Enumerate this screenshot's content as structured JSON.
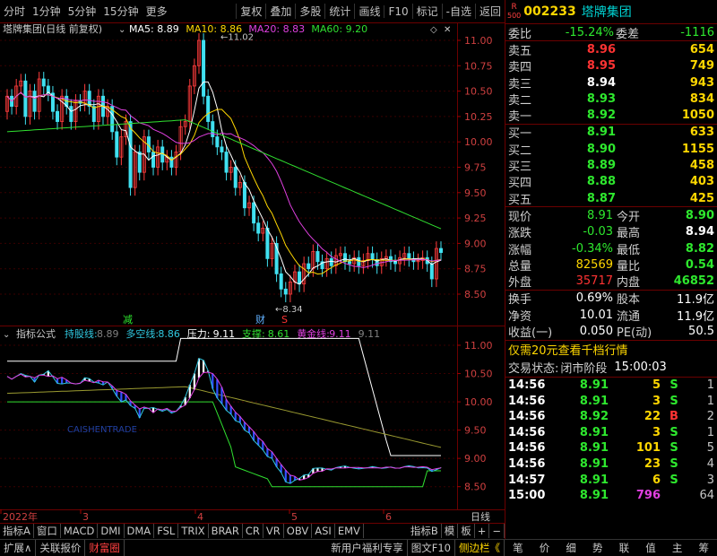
{
  "toolbar": {
    "periods": [
      "分时",
      "1分钟",
      "5分钟",
      "15分钟",
      "更多"
    ],
    "actions": [
      "复权",
      "叠加",
      "多股",
      "统计",
      "画线",
      "F10",
      "标记",
      "-自选",
      "返回"
    ]
  },
  "main_chart": {
    "title": "塔牌集团(日线 前复权)",
    "ma": [
      {
        "label": "MA5: 8.89",
        "color": "#ffffff"
      },
      {
        "label": "MA10: 8.86",
        "color": "#ffd700"
      },
      {
        "label": "MA20: 8.83",
        "color": "#e040e0"
      },
      {
        "label": "MA60: 9.20",
        "color": "#30e030"
      }
    ],
    "y_ticks": [
      "11.00",
      "10.75",
      "10.50",
      "10.25",
      "10.00",
      "9.75",
      "9.50",
      "9.25",
      "9.00",
      "8.75",
      "8.50"
    ],
    "high_label": "11.02",
    "low_label": "8.34",
    "markers": {
      "jian": "减",
      "cai": "财",
      "s": "S"
    }
  },
  "sub_chart": {
    "indicator": "指标公式",
    "items": [
      {
        "label": "持股线: ",
        "value": "8.89",
        "lc": "#30c8e0",
        "vc": "#808080"
      },
      {
        "label": "多空线: ",
        "value": "8.86",
        "lc": "#30c8e0",
        "vc": "#30c8e0"
      },
      {
        "label": "压力: ",
        "value": "9.11",
        "lc": "#ffffff",
        "vc": "#ffffff"
      },
      {
        "label": "支撑: ",
        "value": "8.61",
        "lc": "#30e030",
        "vc": "#30e030"
      },
      {
        "label": "黄金线: ",
        "value": "9.11",
        "lc": "#e040e0",
        "vc": "#e040e0"
      },
      {
        "label": "",
        "value": "9.11",
        "lc": "#808080",
        "vc": "#808080"
      }
    ],
    "y_ticks": [
      "11.00",
      "10.50",
      "10.00",
      "9.50",
      "9.00",
      "8.50"
    ],
    "watermark": "CAISHENTRADE"
  },
  "x_axis": {
    "labels": [
      "2022年",
      "3",
      "4",
      "5",
      "6"
    ],
    "period": "日线"
  },
  "indicator_tabs": [
    "指标A",
    "窗口",
    "MACD",
    "DMI",
    "DMA",
    "FSL",
    "TRIX",
    "BRAR",
    "CR",
    "VR",
    "OBV",
    "ASI",
    "EMV"
  ],
  "tabs_right": [
    "指标B",
    "模",
    "板",
    "+",
    "−"
  ],
  "status_left": [
    {
      "text": "扩展∧",
      "color": "#c8c8c8"
    },
    {
      "text": "关联报价",
      "color": "#c8c8c8"
    },
    {
      "text": "财富圈",
      "color": "#ff4040"
    }
  ],
  "status_mid": [
    {
      "text": "新用户福利专享",
      "color": "#c8c8c8"
    },
    {
      "text": "图文F10",
      "color": "#c8c8c8"
    },
    {
      "text": "侧边栏《",
      "color": "#ffd700"
    }
  ],
  "status_right": [
    "笔",
    "价",
    "细",
    "势",
    "联",
    "值",
    "主",
    "筹"
  ],
  "quote": {
    "badge_r": "R",
    "badge_num": "500",
    "code": "002233",
    "name": "塔牌集团",
    "weibi_label": "委比",
    "weibi": "-15.24%",
    "weicha_label": "委差",
    "weicha": "-1116",
    "asks": [
      {
        "label": "卖五",
        "price": "8.96",
        "vol": "654",
        "pc": "#ff3333"
      },
      {
        "label": "卖四",
        "price": "8.95",
        "vol": "749",
        "pc": "#ff3333"
      },
      {
        "label": "卖三",
        "price": "8.94",
        "vol": "943",
        "pc": "#ffffff"
      },
      {
        "label": "卖二",
        "price": "8.93",
        "vol": "834",
        "pc": "#2ee82e"
      },
      {
        "label": "卖一",
        "price": "8.92",
        "vol": "1050",
        "pc": "#2ee82e"
      }
    ],
    "bids": [
      {
        "label": "买一",
        "price": "8.91",
        "vol": "633",
        "pc": "#2ee82e"
      },
      {
        "label": "买二",
        "price": "8.90",
        "vol": "1155",
        "pc": "#2ee82e"
      },
      {
        "label": "买三",
        "price": "8.89",
        "vol": "458",
        "pc": "#2ee82e"
      },
      {
        "label": "买四",
        "price": "8.88",
        "vol": "403",
        "pc": "#2ee82e"
      },
      {
        "label": "买五",
        "price": "8.87",
        "vol": "425",
        "pc": "#2ee82e"
      }
    ],
    "stats": [
      {
        "l1": "现价",
        "v1": "8.91",
        "c1": "#2ee82e",
        "l2": "今开",
        "v2": "8.90",
        "c2": "#2ee82e"
      },
      {
        "l1": "涨跌",
        "v1": "-0.03",
        "c1": "#2ee82e",
        "l2": "最高",
        "v2": "8.94",
        "c2": "#ffffff"
      },
      {
        "l1": "涨幅",
        "v1": "-0.34%",
        "c1": "#2ee82e",
        "l2": "最低",
        "v2": "8.82",
        "c2": "#2ee82e"
      },
      {
        "l1": "总量",
        "v1": "82569",
        "c1": "#ffd700",
        "l2": "量比",
        "v2": "0.54",
        "c2": "#2ee82e"
      },
      {
        "l1": "外盘",
        "v1": "35717",
        "c1": "#ff3333",
        "l2": "内盘",
        "v2": "46852",
        "c2": "#2ee82e"
      }
    ],
    "stats2": [
      {
        "l1": "换手",
        "v1": "0.69%",
        "l2": "股本",
        "v2": "11.9亿"
      },
      {
        "l1": "净资",
        "v1": "10.01",
        "l2": "流通",
        "v2": "11.9亿"
      },
      {
        "l1": "收益(一)",
        "v1": "0.050",
        "l2": "PE(动)",
        "v2": "50.5"
      }
    ],
    "promo": "仅需20元查看千档行情",
    "trade_state_label": "交易状态:",
    "trade_state": "闭市阶段",
    "trade_time": "15:00:03",
    "ticks": [
      {
        "t": "14:56",
        "p": "8.91",
        "v": "5",
        "bs": "S",
        "n": "1",
        "pc": "#2ee82e",
        "vc": "#ffd700",
        "bc": "#2ee82e"
      },
      {
        "t": "14:56",
        "p": "8.91",
        "v": "3",
        "bs": "S",
        "n": "1",
        "pc": "#2ee82e",
        "vc": "#ffd700",
        "bc": "#2ee82e"
      },
      {
        "t": "14:56",
        "p": "8.92",
        "v": "22",
        "bs": "B",
        "n": "2",
        "pc": "#2ee82e",
        "vc": "#ffd700",
        "bc": "#ff3333"
      },
      {
        "t": "14:56",
        "p": "8.91",
        "v": "3",
        "bs": "S",
        "n": "1",
        "pc": "#2ee82e",
        "vc": "#ffd700",
        "bc": "#2ee82e"
      },
      {
        "t": "14:56",
        "p": "8.91",
        "v": "101",
        "bs": "S",
        "n": "5",
        "pc": "#2ee82e",
        "vc": "#ffd700",
        "bc": "#2ee82e"
      },
      {
        "t": "14:56",
        "p": "8.91",
        "v": "23",
        "bs": "S",
        "n": "4",
        "pc": "#2ee82e",
        "vc": "#ffd700",
        "bc": "#2ee82e"
      },
      {
        "t": "14:57",
        "p": "8.91",
        "v": "6",
        "bs": "S",
        "n": "3",
        "pc": "#2ee82e",
        "vc": "#ffd700",
        "bc": "#2ee82e"
      },
      {
        "t": "15:00",
        "p": "8.91",
        "v": "796",
        "bs": "",
        "n": "64",
        "pc": "#2ee82e",
        "vc": "#e040e0",
        "bc": "#2ee82e"
      }
    ]
  }
}
